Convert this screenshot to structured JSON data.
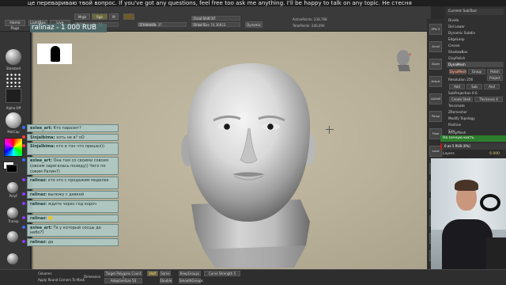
{
  "ticker": {
    "text": "це перевариваю твой вопрос. If you've got any questions, feel free too ask me anything. I'll be happy to talk on any topic. Не стесня"
  },
  "header_overlay": {
    "text": "ralinaz - 1 000 RUB"
  },
  "top_shelf": {
    "home_page": "Home Page",
    "lightbox": "LightBox",
    "live_boolean": "Live Boolean",
    "mrgb": "Mrgb",
    "rgb": "Rgb",
    "m": "M",
    "rgb_intensity": "Rgb Intensity 10",
    "z_intensity": "Z Intensity 37",
    "focal_shift": "Focal Shift 37",
    "draw_size": "Draw Size 74.36923",
    "dynamic": "Dynamic",
    "active_points": "ActivePoints: 238,768",
    "total_points": "TotalPoints: 246,090"
  },
  "left_tools": {
    "standard": "Standard",
    "smooth": "SmoothTool",
    "dots": "Dots",
    "alpha_off": "Alpha Off",
    "texture_off": "Texture Off",
    "matcap": "MatCap",
    "gradient": "Gradient",
    "switch_color": "SwitchColor",
    "alternate": "Alternate",
    "polyf": "PolyF",
    "transp": "Transp"
  },
  "right_bar": {
    "items": [
      "SPix 3",
      "Scroll",
      "Zoom",
      "Actual",
      "AAHalf",
      "Persp",
      "Floor",
      "Local",
      "XYZ",
      "Frame",
      "Move",
      "Scale",
      "Rotate",
      "PolyF"
    ]
  },
  "right_panel": {
    "title": "Current SubTool",
    "items": [
      "Divide",
      "Del Lower",
      "Dynamic Subdiv",
      "EdgeLoop",
      "Crease",
      "ShadowBox",
      "ClayPolish",
      "DynaMesh"
    ],
    "dynamesh_btn": "DynaMesh",
    "groups": "Group",
    "polish": "Polish",
    "project": "Project",
    "resolution": "Resolution 256",
    "add": "Add",
    "sub": "Sub",
    "and": "And",
    "subprojection": "SubProjection 0.6",
    "create_shell": "Create Shell",
    "thickness": "Thickness 4",
    "tessimate": "Tessimate",
    "zremesher": "ZRemesher",
    "modify_topology": "Modify Topology",
    "position": "Position",
    "size": "Size",
    "mesh_integrity": "MeshIntegrity",
    "array_mesh": "ArrayMesh"
  },
  "donation": {
    "title": "На сочную кисть",
    "progress_label": "0 из 5 RUB (0%)",
    "progress": 0.03,
    "layers_label": "Layers",
    "layers_value": "6 000"
  },
  "chat": {
    "messages": [
      {
        "nick": "exlee_art:",
        "text": "Кто паразит?",
        "color": "#3a6cff"
      },
      {
        "nick": "Sinjalbima:",
        "text": "хоть не в? оО",
        "color": "#ff3a3a"
      },
      {
        "nick": "Sinjalbima:",
        "text": "кто в тон что пришел))",
        "color": "#ff3a3a"
      },
      {
        "nick": "exlee_art:",
        "text": "Она тем со своими совсем совсем зарегалась позиду)) Чего по совим Ралин?)",
        "color": "#3a6cff"
      },
      {
        "nick": "ralinaz:",
        "text": "кто это с продажим моделек",
        "color": "#8a3aff"
      },
      {
        "nick": "ralinaz:",
        "text": "выложу с девкой",
        "color": "#8a3aff"
      },
      {
        "nick": "ralinaz:",
        "text": "ждите через год короч",
        "color": "#8a3aff"
      },
      {
        "nick": "ralinaz:",
        "text": "🙂",
        "color": "#8a3aff"
      },
      {
        "nick": "exlee_art:",
        "text": "Та у который сосцы до небо?)",
        "color": "#3a6cff"
      },
      {
        "nick": "ralinaz:",
        "text": "да",
        "color": "#8a3aff"
      }
    ]
  },
  "bottom_bar": {
    "columns": "Columns",
    "apply_round_corners": "Apply Round Corners To Mask",
    "dimensions": "Dimension",
    "target_polygons": "Target Polygons Count 5",
    "adaptive_size": "AdaptiveSize 50",
    "half": "Half",
    "same": "Same",
    "double": "Double",
    "keep_groups": "KeepGroups",
    "smooth_groups": "SmoothGroups",
    "curve_strength": "Curve Strength 5"
  }
}
